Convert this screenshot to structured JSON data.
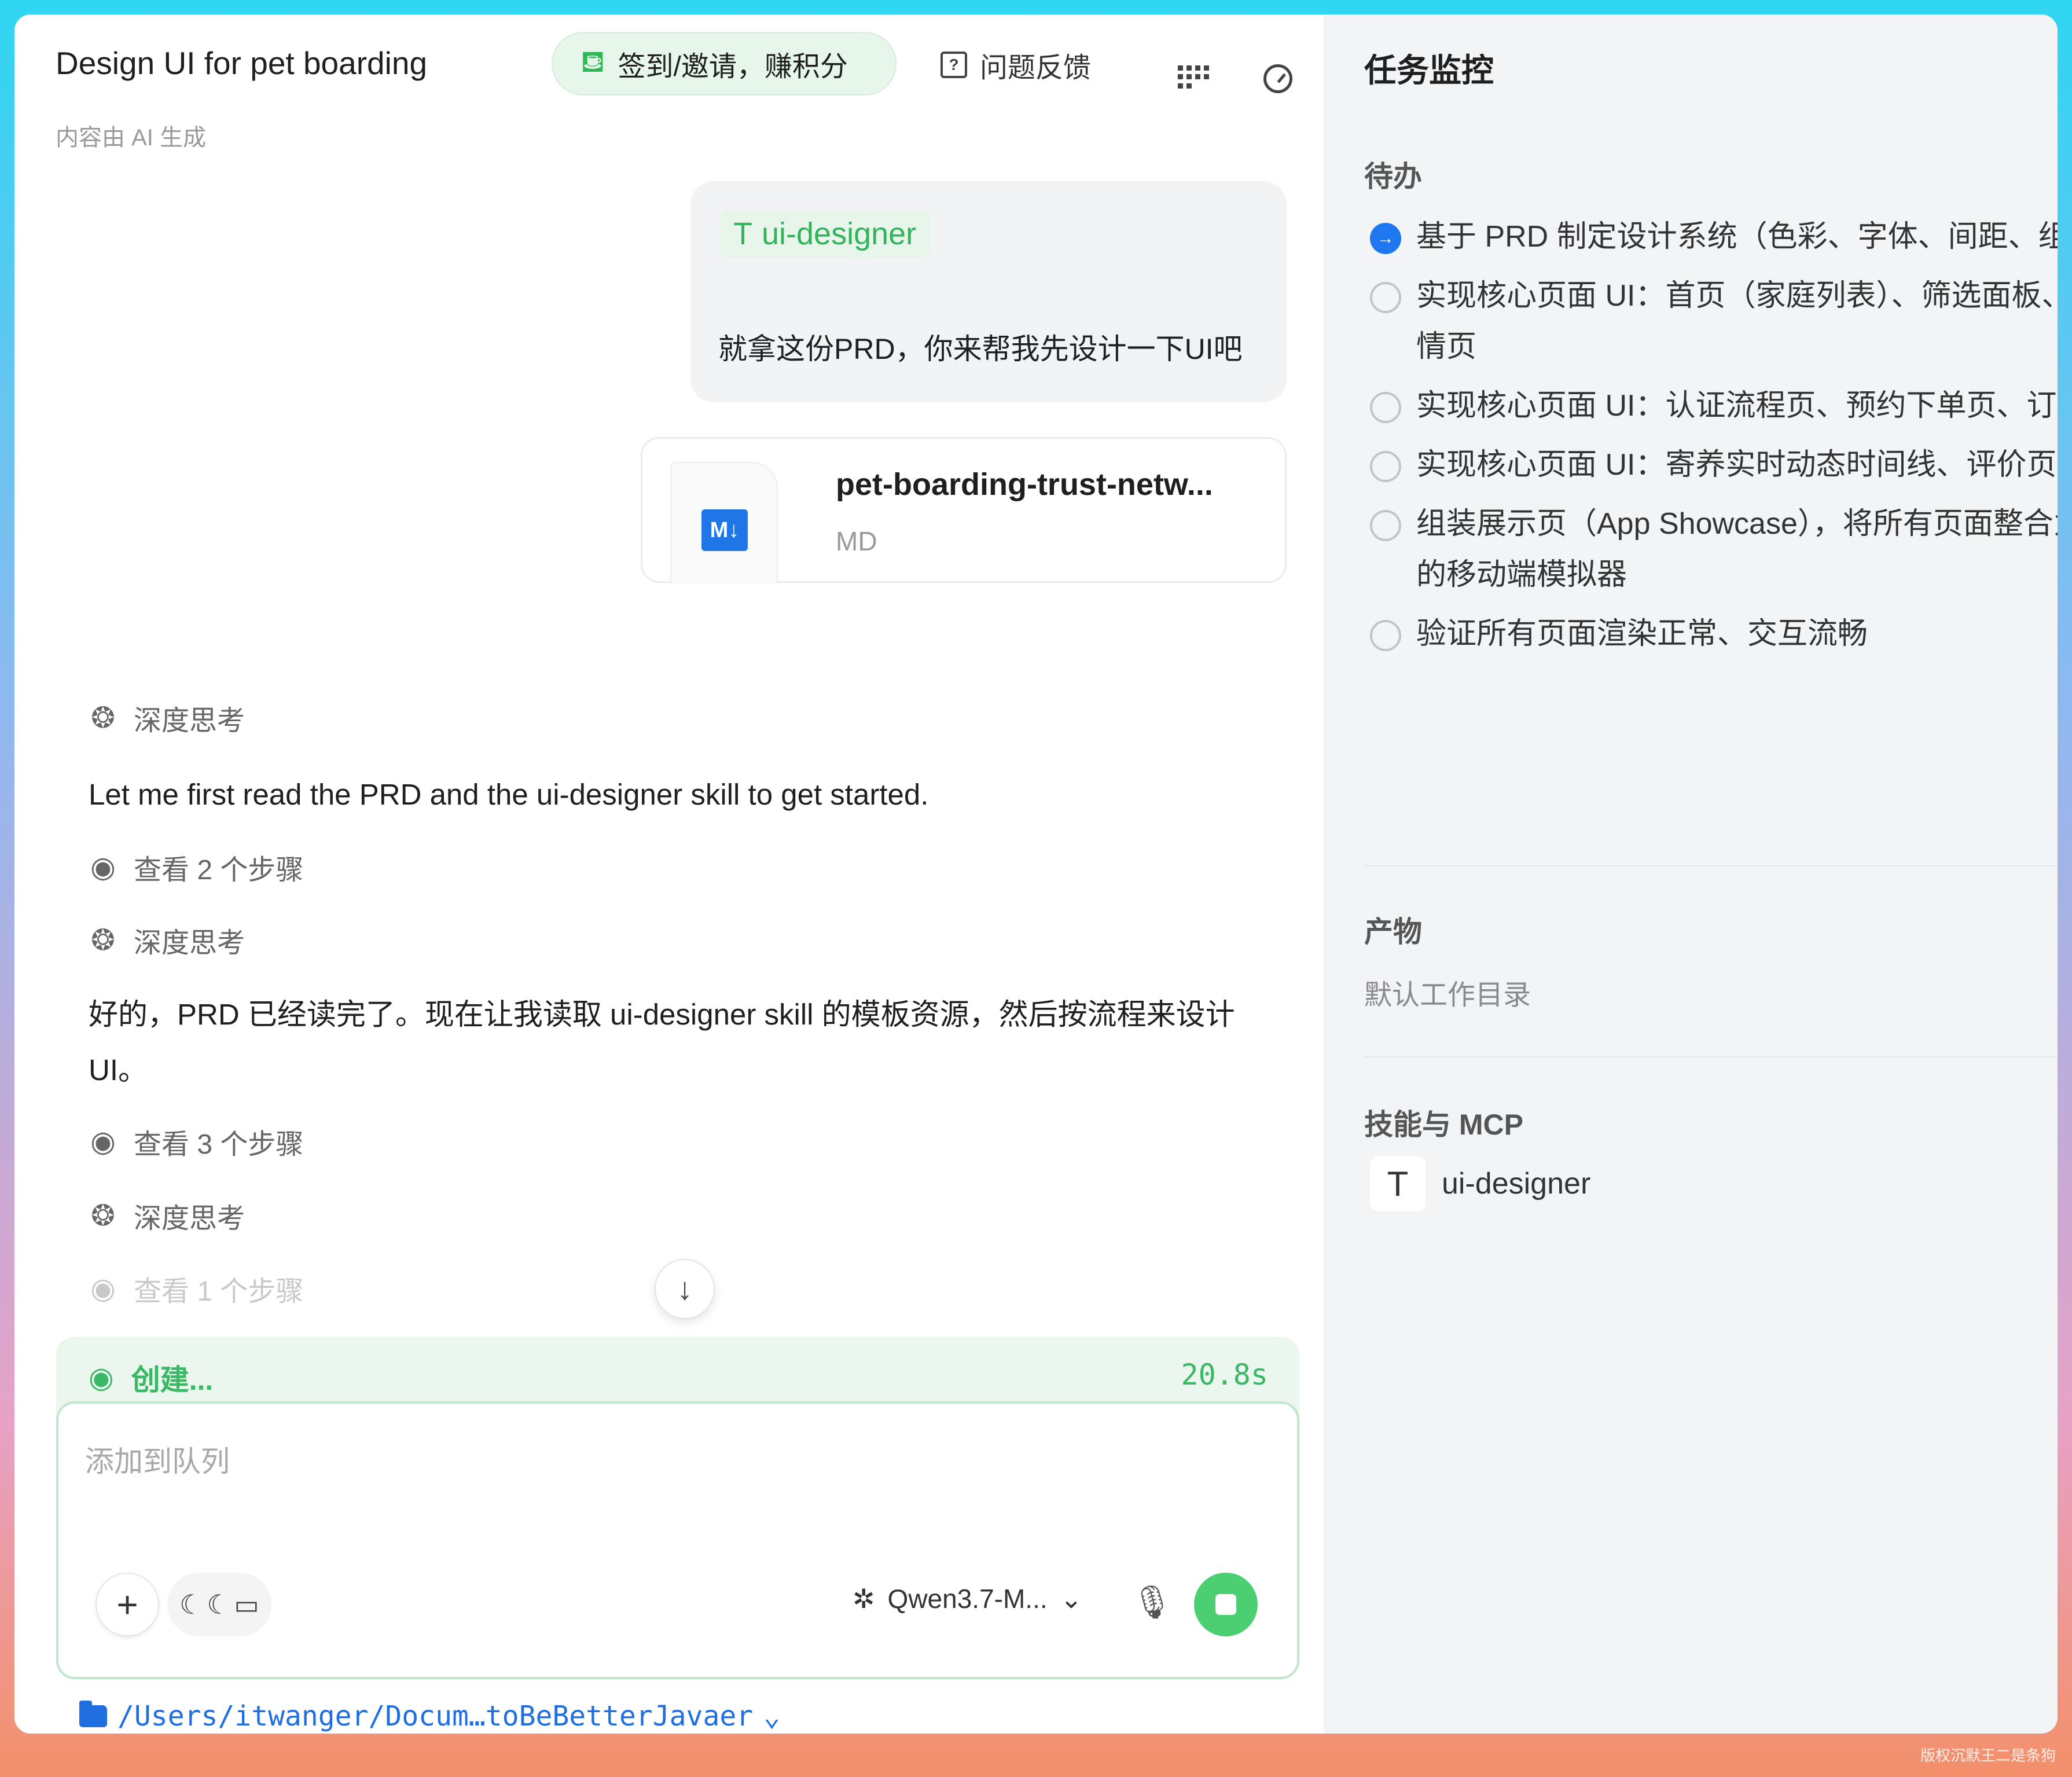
{
  "header": {
    "title": "Design UI for pet boarding",
    "subtitle": "内容由 AI 生成",
    "checkin_label": "签到/邀请，赚积分",
    "feedback_label": "问题反馈"
  },
  "user_message": {
    "skill_chip": "ui-designer",
    "text": "就拿这份PRD，你来帮我先设计一下UI吧"
  },
  "file_card": {
    "name": "pet-boarding-trust-netw...",
    "type": "MD",
    "badge": "M↓"
  },
  "conversation": {
    "thinking_label": "深度思考",
    "message_1": "Let me first read the PRD and the ui-designer skill to get started.",
    "steps_1": "查看 2 个步骤",
    "message_2": "好的，PRD 已经读完了。现在让我读取 ui-designer skill 的模板资源，然后按流程来设计 UI。",
    "steps_2": "查看 3 个步骤",
    "steps_3": "查看 1 个步骤"
  },
  "status": {
    "label": "创建...",
    "elapsed": "20.8s"
  },
  "input": {
    "placeholder": "添加到队列",
    "model": "Qwen3.7-M..."
  },
  "workspace_path": "/Users/itwanger/Docum…toBeBetterJavaer",
  "monitor": {
    "title": "任务监控",
    "todo_heading": "待办",
    "todos": [
      {
        "text": "基于 PRD 制定设计系统（色彩、字体、间距、组件风格）",
        "status": "in_progress"
      },
      {
        "text": "实现核心页面 UI：首页（家庭列表）、筛选面板、家庭详情页",
        "status": "pending"
      },
      {
        "text": "实现核心页面 UI：认证流程页、预约下单页、订单详情页",
        "status": "pending"
      },
      {
        "text": "实现核心页面 UI：寄养实时动态时间线、评价页",
        "status": "pending"
      },
      {
        "text": "组装展示页（App Showcase），将所有页面整合为可交互的移动端模拟器",
        "status": "pending"
      },
      {
        "text": "验证所有页面渲染正常、交互流畅",
        "status": "pending"
      }
    ],
    "artifacts_heading": "产物",
    "artifacts_default": "默认工作目录",
    "skills_heading": "技能与 MCP",
    "skills": [
      "ui-designer"
    ]
  },
  "watermark": "版权沉默王二是条狗",
  "colors": {
    "accent_green": "#3ab865",
    "primary_blue": "#1f78f0",
    "panel_bg": "#f3f4f6"
  }
}
